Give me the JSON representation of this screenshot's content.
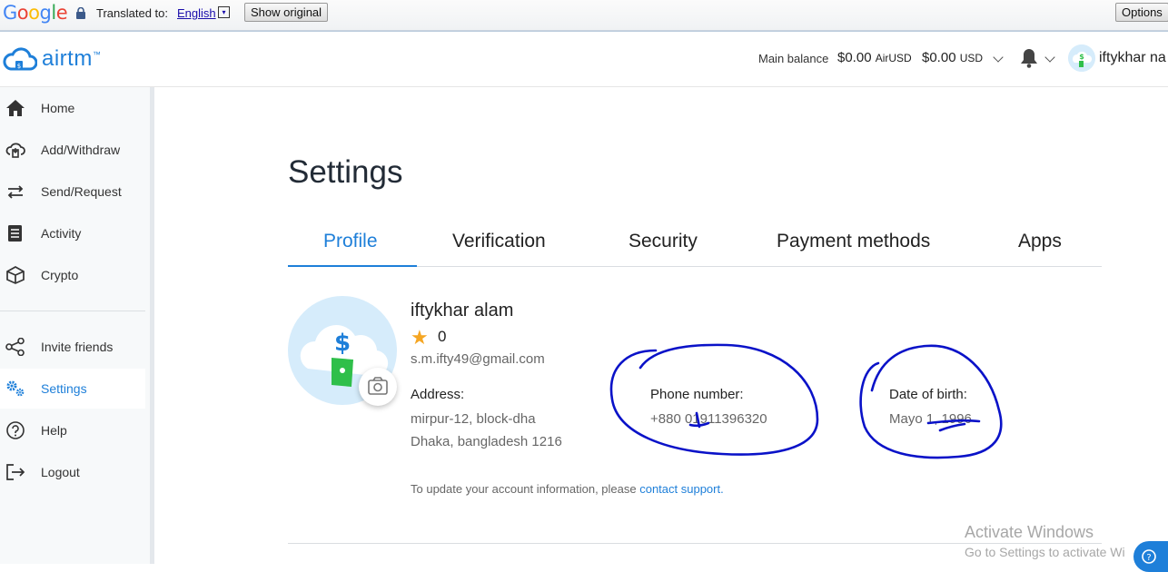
{
  "translate_bar": {
    "logo": "Google",
    "translated_to_label": "Translated to:",
    "language": "English",
    "language_dropdown_glyph": "▾",
    "show_original_label": "Show original",
    "options_label": "Options"
  },
  "header": {
    "brand": "airtm",
    "brand_mark": "™",
    "main_balance_label": "Main balance",
    "airusd_amount": "$0.00",
    "airusd_unit": "AirUSD",
    "usd_amount": "$0.00",
    "usd_unit": "USD",
    "user_name": "iftykhar na"
  },
  "sidebar": {
    "items": [
      {
        "label": "Home",
        "icon": "home-icon"
      },
      {
        "label": "Add/Withdraw",
        "icon": "cloud-transfer-icon"
      },
      {
        "label": "Send/Request",
        "icon": "transfer-arrows-icon"
      },
      {
        "label": "Activity",
        "icon": "document-list-icon"
      },
      {
        "label": "Crypto",
        "icon": "cube-icon"
      },
      {
        "label": "Invite friends",
        "icon": "share-icon"
      },
      {
        "label": "Settings",
        "icon": "gears-icon"
      },
      {
        "label": "Help",
        "icon": "question-circle-icon"
      },
      {
        "label": "Logout",
        "icon": "logout-icon"
      }
    ],
    "active": "Settings"
  },
  "main": {
    "title": "Settings",
    "tabs": [
      {
        "label": "Profile"
      },
      {
        "label": "Verification"
      },
      {
        "label": "Security"
      },
      {
        "label": "Payment methods"
      },
      {
        "label": "Apps"
      }
    ],
    "active_tab": "Profile",
    "profile": {
      "name": "iftykhar alam",
      "star": "★",
      "rating": "0",
      "email": "s.m.ifty49@gmail.com",
      "address_label": "Address:",
      "address_line1": "mirpur-12, block-dha",
      "address_line2": "Dhaka, bangladesh 1216",
      "phone_label": "Phone number:",
      "phone_value": "+880 01911396320",
      "dob_label": "Date of birth:",
      "dob_value": "Mayo 1, 1996"
    },
    "update_note_text": "To update your account information, please ",
    "update_note_link": "contact support."
  },
  "watermark": {
    "line1": "Activate Windows",
    "line2": "Go to Settings to activate Wi"
  },
  "colors": {
    "accent": "#1e7fd9",
    "star": "#f5a623",
    "annotation_ink": "#0a12c8",
    "avatar_bg": "#d6ecfb",
    "bill_green": "#2fbf4a"
  }
}
